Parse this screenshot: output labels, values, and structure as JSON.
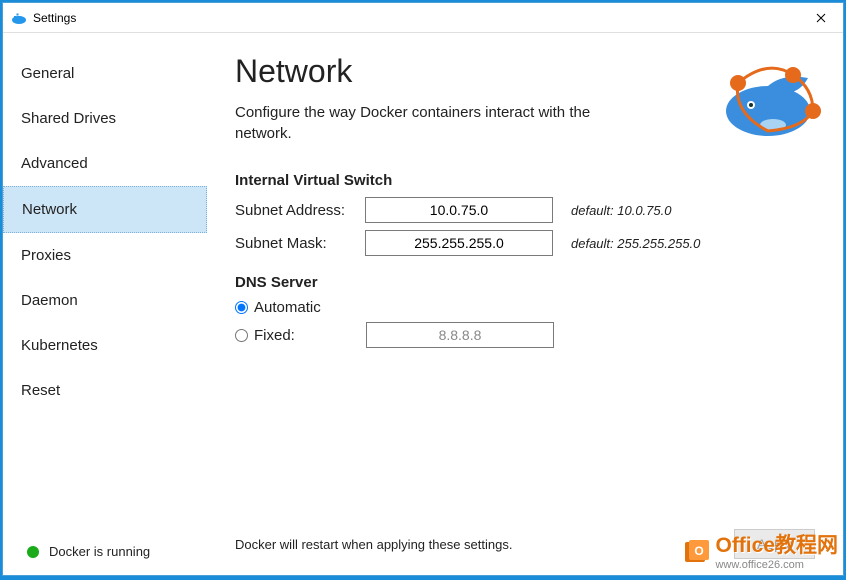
{
  "titlebar": {
    "title": "Settings"
  },
  "sidebar": {
    "items": [
      {
        "label": "General"
      },
      {
        "label": "Shared Drives"
      },
      {
        "label": "Advanced"
      },
      {
        "label": "Network",
        "selected": true
      },
      {
        "label": "Proxies"
      },
      {
        "label": "Daemon"
      },
      {
        "label": "Kubernetes"
      },
      {
        "label": "Reset"
      }
    ]
  },
  "status": {
    "text": "Docker is running",
    "color": "#1aaa1a"
  },
  "main": {
    "title": "Network",
    "subtitle": "Configure the way Docker containers interact with the network.",
    "ivs": {
      "header": "Internal Virtual Switch",
      "subnet_addr_label": "Subnet Address:",
      "subnet_addr_value": "10.0.75.0",
      "subnet_addr_default": "default: 10.0.75.0",
      "subnet_mask_label": "Subnet Mask:",
      "subnet_mask_value": "255.255.255.0",
      "subnet_mask_default": "default: 255.255.255.0"
    },
    "dns": {
      "header": "DNS Server",
      "automatic_label": "Automatic",
      "fixed_label": "Fixed:",
      "fixed_value": "8.8.8.8",
      "selected": "automatic"
    },
    "footer": {
      "note": "Docker will restart when applying these settings.",
      "apply_label": "Apply"
    }
  },
  "watermark": {
    "brand": "Office教程网",
    "url": "www.office26.com"
  }
}
